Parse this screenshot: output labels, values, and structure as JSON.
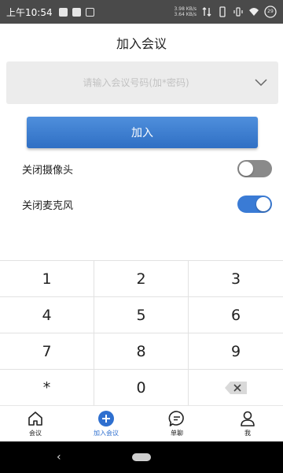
{
  "status_bar": {
    "time": "上午10:54",
    "net_speed_up": "3.98 KB/s",
    "net_speed_down": "3.64 KB/s",
    "battery": "29"
  },
  "header": {
    "title": "加入会议"
  },
  "meeting_input": {
    "placeholder": "请输入会议号码(加*密码)",
    "value": ""
  },
  "join_button": {
    "label": "加入"
  },
  "toggles": [
    {
      "label": "关闭摄像头",
      "state": "off"
    },
    {
      "label": "关闭麦克风",
      "state": "on"
    }
  ],
  "keypad": {
    "keys": [
      "1",
      "2",
      "3",
      "4",
      "5",
      "6",
      "7",
      "8",
      "9",
      "*",
      "0"
    ],
    "backspace_icon": "backspace-icon"
  },
  "bottom_nav": {
    "items": [
      {
        "label": "会议",
        "icon": "home-icon"
      },
      {
        "label": "加入会议",
        "icon": "add-circle-icon",
        "active": true
      },
      {
        "label": "单聊",
        "icon": "chat-icon"
      },
      {
        "label": "我",
        "icon": "user-icon"
      }
    ]
  },
  "colors": {
    "accent": "#3a7bd5",
    "join_button": "#3f7fd0",
    "status_bar": "#4a4a4a",
    "input_background": "#ececec",
    "switch_off": "#8a8a8a"
  }
}
